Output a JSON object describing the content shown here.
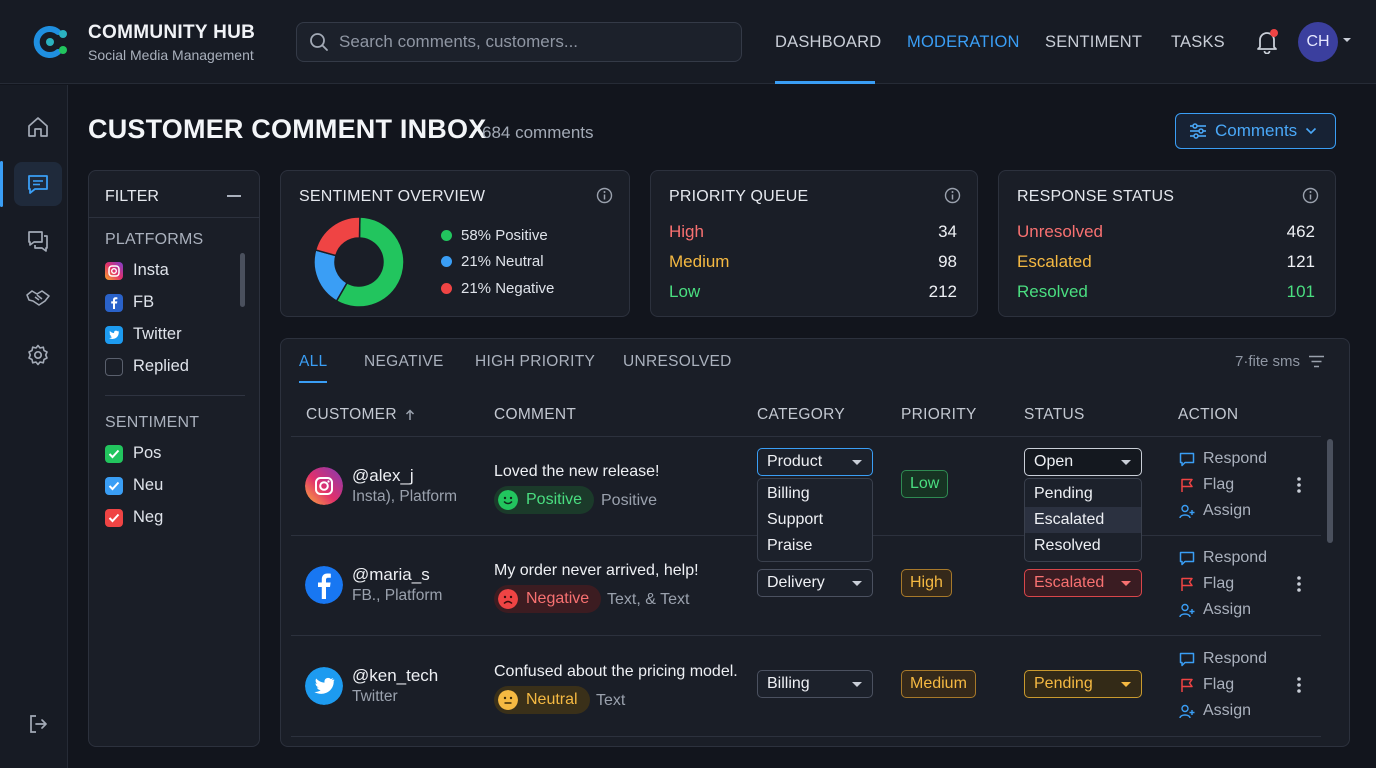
{
  "brand": {
    "title": "COMMUNITY HUB",
    "subtitle": "Social Media Management"
  },
  "search": {
    "placeholder": "Search comments, customers..."
  },
  "nav": {
    "tabs": [
      "DASHBOARD",
      "MODERATION",
      "SENTIMENT",
      "TASKS"
    ],
    "active_underline": "DASHBOARD",
    "active_color": "MODERATION"
  },
  "user": {
    "initials": "CH"
  },
  "sidebar": {
    "icons": [
      "home-icon",
      "comments-icon",
      "chat-icon",
      "handshake-icon",
      "settings-icon",
      "logout-icon"
    ],
    "active": "comments-icon"
  },
  "page": {
    "title": "CUSTOMER COMMENT INBOX",
    "count": "684 comments",
    "view_button": "Comments"
  },
  "filter": {
    "title": "FILTER",
    "platforms_label": "PLATFORMS",
    "platforms": [
      {
        "label": "Insta",
        "icon": "instagram-icon"
      },
      {
        "label": "FB",
        "icon": "facebook-icon"
      },
      {
        "label": "Twitter",
        "icon": "twitter-icon"
      },
      {
        "label": "Replied",
        "icon": "checkbox-empty"
      }
    ],
    "sentiment_label": "SENTIMENT",
    "sentiment": [
      {
        "label": "Pos",
        "checked": true,
        "color": "#22c55e"
      },
      {
        "label": "Neu",
        "checked": true,
        "color": "#3a9ef5"
      },
      {
        "label": "Neg",
        "checked": true,
        "color": "#ef4444"
      }
    ]
  },
  "sentiment_overview": {
    "title": "SENTIMENT OVERVIEW",
    "legend": [
      "58% Positive",
      "21% Neutral",
      "21% Negative"
    ],
    "values": [
      58,
      21,
      21
    ],
    "colors": [
      "#22c55e",
      "#3a9ef5",
      "#ef4444"
    ]
  },
  "priority_queue": {
    "title": "PRIORITY QUEUE",
    "rows": [
      {
        "label": "High",
        "value": "34",
        "color": "#f87171"
      },
      {
        "label": "Medium",
        "value": "98",
        "color": "#f5b942"
      },
      {
        "label": "Low",
        "value": "212",
        "color": "#4ade80"
      }
    ]
  },
  "response_status": {
    "title": "RESPONSE STATUS",
    "rows": [
      {
        "label": "Unresolved",
        "value": "462",
        "color": "#f87171",
        "value_color": "#eef0f4"
      },
      {
        "label": "Escalated",
        "value": "121",
        "color": "#f5b942",
        "value_color": "#eef0f4"
      },
      {
        "label": "Resolved",
        "value": "101",
        "color": "#4ade80",
        "value_color": "#4ade80"
      }
    ]
  },
  "table": {
    "tabs": [
      "ALL",
      "NEGATIVE",
      "HIGH PRIORITY",
      "UNRESOLVED"
    ],
    "active_tab": "ALL",
    "filter_label": "7·fite sms",
    "headers": [
      "CUSTOMER",
      "COMMENT",
      "CATEGORY",
      "PRIORITY",
      "STATUS",
      "ACTION"
    ],
    "actions": [
      "Respond",
      "Flag",
      "Assign"
    ],
    "rows": [
      {
        "name": "@alex_j",
        "platform": "Insta), Platform",
        "platform_icon": "instagram-icon",
        "comment": "Loved the new release!",
        "sentiment": "Positive",
        "sentiment_type": "Positive",
        "category": "Product",
        "category_options": [
          "Billing",
          "Support",
          "Praise"
        ],
        "priority": "Low",
        "status": "Open",
        "status_options": [
          "Pending",
          "Escalated",
          "Resolved"
        ]
      },
      {
        "name": "@maria_s",
        "platform": "FB., Platform",
        "platform_icon": "facebook-icon",
        "comment": "My order never arrived, help!",
        "sentiment": "Negative",
        "sentiment_type": "Text, & Text",
        "category": "Delivery",
        "priority": "High",
        "status": "Escalated"
      },
      {
        "name": "@ken_tech",
        "platform": "Twitter",
        "platform_icon": "twitter-icon",
        "comment": "Confused about the pricing model.",
        "sentiment": "Neutral",
        "sentiment_type": "Text",
        "category": "Billing",
        "priority": "Medium",
        "status": "Pending"
      }
    ]
  }
}
